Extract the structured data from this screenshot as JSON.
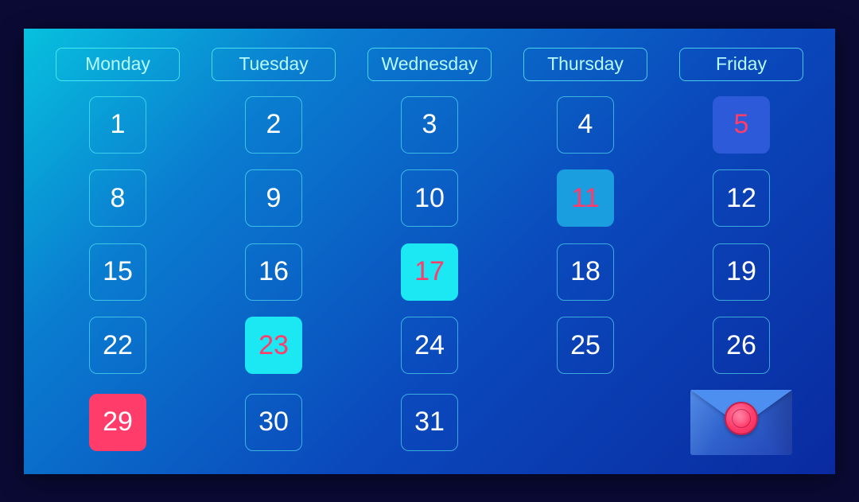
{
  "calendar": {
    "headers": [
      "Monday",
      "Tuesday",
      "Wednesday",
      "Thursday",
      "Friday"
    ],
    "weeks": [
      [
        {
          "num": "1",
          "style": "normal"
        },
        {
          "num": "2",
          "style": "normal"
        },
        {
          "num": "3",
          "style": "normal"
        },
        {
          "num": "4",
          "style": "normal"
        },
        {
          "num": "5",
          "style": "hl-blue-dark"
        }
      ],
      [
        {
          "num": "8",
          "style": "normal"
        },
        {
          "num": "9",
          "style": "normal"
        },
        {
          "num": "10",
          "style": "normal"
        },
        {
          "num": "11",
          "style": "hl-blue-med"
        },
        {
          "num": "12",
          "style": "normal"
        }
      ],
      [
        {
          "num": "15",
          "style": "normal"
        },
        {
          "num": "16",
          "style": "normal"
        },
        {
          "num": "17",
          "style": "hl-cyan"
        },
        {
          "num": "18",
          "style": "normal"
        },
        {
          "num": "19",
          "style": "normal"
        }
      ],
      [
        {
          "num": "22",
          "style": "normal"
        },
        {
          "num": "23",
          "style": "hl-cyan"
        },
        {
          "num": "24",
          "style": "normal"
        },
        {
          "num": "25",
          "style": "normal"
        },
        {
          "num": "26",
          "style": "normal"
        }
      ],
      [
        {
          "num": "29",
          "style": "hl-red"
        },
        {
          "num": "30",
          "style": "normal"
        },
        {
          "num": "31",
          "style": "normal"
        },
        {
          "type": "empty"
        },
        {
          "type": "mail"
        }
      ]
    ]
  },
  "colors": {
    "accent_red": "#ff3c6a",
    "accent_cyan": "#1be8f2",
    "text_light": "#ffffff"
  }
}
